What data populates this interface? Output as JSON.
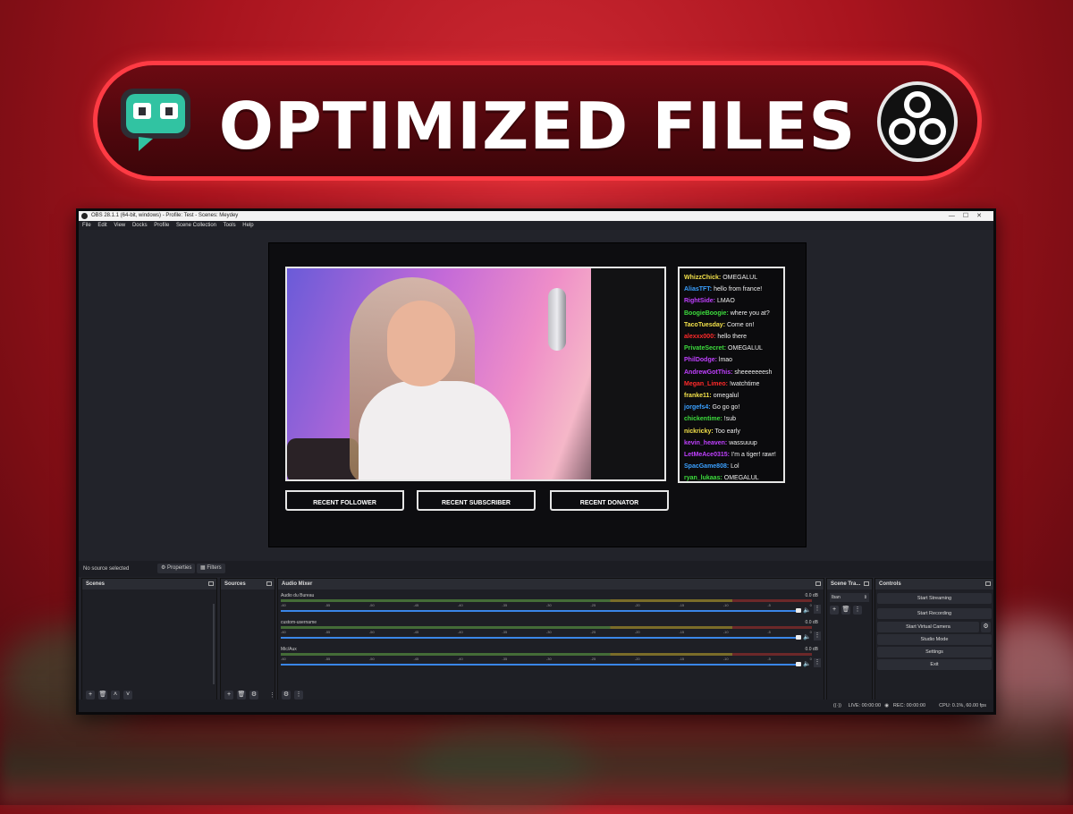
{
  "banner": {
    "title": "OPTIMIZED FILES"
  },
  "colors": {
    "accent": "#ff3b44",
    "meter_blue": "#3a86e8"
  },
  "window": {
    "title": "OBS 28.1.1 (64-bit, windows) - Profile: Test - Scenes: Meydey",
    "menu": [
      "File",
      "Edit",
      "View",
      "Docks",
      "Profile",
      "Scene Collection",
      "Tools",
      "Help"
    ]
  },
  "chat": [
    {
      "user": "WhizzChick:",
      "msg": "OMEGALUL",
      "color": "#f2e04a"
    },
    {
      "user": "AliasTFT:",
      "msg": "hello from france!",
      "color": "#3aa0ff"
    },
    {
      "user": "RightSide:",
      "msg": "LMAO",
      "color": "#c040ff"
    },
    {
      "user": "BoogieBoogie:",
      "msg": "where you at?",
      "color": "#3ddc3d"
    },
    {
      "user": "TacoTuesday:",
      "msg": "Come on!",
      "color": "#f2e04a"
    },
    {
      "user": "alexxx000:",
      "msg": "hello there",
      "color": "#ff2a2a"
    },
    {
      "user": "PrivateSecret:",
      "msg": "OMEGALUL",
      "color": "#3ddc3d"
    },
    {
      "user": "PhilDodge:",
      "msg": "lmao",
      "color": "#c040ff"
    },
    {
      "user": "AndrewGotThis:",
      "msg": "sheeeeeeesh",
      "color": "#c040ff"
    },
    {
      "user": "Megan_Limeo:",
      "msg": "!watchtime",
      "color": "#ff2a2a"
    },
    {
      "user": "franke11:",
      "msg": "omegalul",
      "color": "#f2e04a"
    },
    {
      "user": "jorgefs4:",
      "msg": "Go go go!",
      "color": "#3aa0ff"
    },
    {
      "user": "chickentime:",
      "msg": "!sub",
      "color": "#3ddc3d"
    },
    {
      "user": "nickricky:",
      "msg": "Too early",
      "color": "#f2e04a"
    },
    {
      "user": "kevin_heaven:",
      "msg": "wassuuup",
      "color": "#c040ff"
    },
    {
      "user": "LetMeAce0315:",
      "msg": "I'm a tiger! rawr!",
      "color": "#c040ff"
    },
    {
      "user": "SpacGame808:",
      "msg": "Lol",
      "color": "#3aa0ff"
    },
    {
      "user": "ryan_lukaas:",
      "msg": "OMEGALUL",
      "color": "#3ddc3d"
    }
  ],
  "overlay_labels": [
    "RECENT FOLLOWER",
    "RECENT SUBSCRIBER",
    "RECENT DONATOR"
  ],
  "status": {
    "no_source": "No source selected",
    "properties": "Properties",
    "filters": "Filters"
  },
  "docks": {
    "scenes": "Scenes",
    "sources": "Sources",
    "audio_mixer": "Audio Mixer",
    "scene_transitions": "Scene Tra...",
    "controls": "Controls"
  },
  "mixer": {
    "channels": [
      {
        "name": "Audio du Bureau",
        "db": "0.0 dB"
      },
      {
        "name": "custom-username",
        "db": "0.0 dB"
      },
      {
        "name": "Mic/Aux",
        "db": "0.0 dB"
      }
    ],
    "ticks": [
      "-60",
      "-55",
      "-50",
      "-45",
      "-40",
      "-35",
      "-30",
      "-25",
      "-20",
      "-15",
      "-10",
      "-5",
      "0"
    ]
  },
  "transition": {
    "value": "Iban"
  },
  "controls": {
    "start_streaming": "Start Streaming",
    "start_recording": "Start Recording",
    "start_virtual_camera": "Start Virtual Camera",
    "studio_mode": "Studio Mode",
    "settings": "Settings",
    "exit": "Exit"
  },
  "footer": {
    "live": "LIVE: 00:00:00",
    "rec": "REC: 00:00:00",
    "cpu": "CPU: 0.1%, 60.00 fps"
  }
}
